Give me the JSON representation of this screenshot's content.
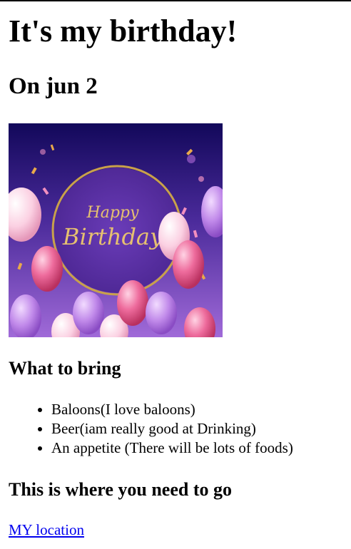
{
  "page": {
    "title": "It's my birthday!",
    "subtitle": "On jun 2"
  },
  "banner": {
    "greeting_top": "Happy",
    "greeting_bottom": "Birthday"
  },
  "bring_section": {
    "heading": "What to bring",
    "items": [
      "Baloons(I love baloons)",
      "Beer(iam really good at Drinking)",
      "An appetite (There will be lots of foods)"
    ]
  },
  "location_section": {
    "heading": "This is where you need to go",
    "link_label": "MY location"
  },
  "colors": {
    "link": "#0000ee",
    "banner_bg_top": "#1a0a5e",
    "banner_bg_bottom": "#9b59d0",
    "ring_gold": "#c9a14a",
    "balloon_pink": "#e8558f",
    "balloon_light": "#f8c8dc",
    "balloon_purple": "#b57be0"
  }
}
